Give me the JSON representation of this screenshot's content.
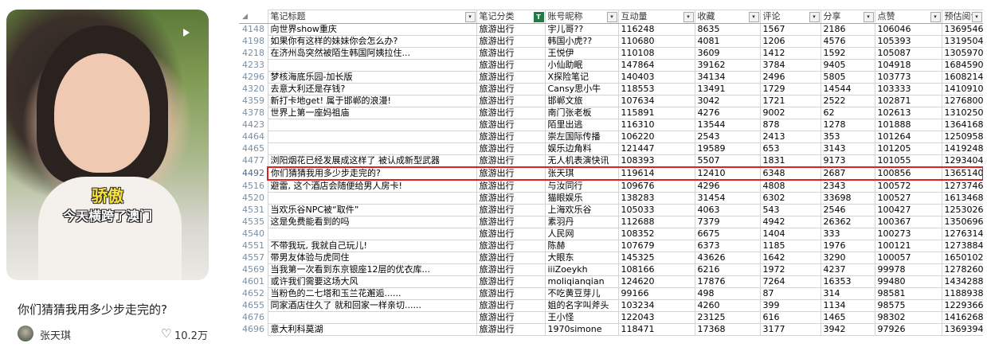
{
  "card": {
    "caption_line1": "骄傲",
    "caption_line2": "今天横跨了澳门",
    "title": "你们猜猜我用多少步走完的?",
    "author": "张天琪",
    "likes": "10.2万",
    "icons": {
      "play": "play-icon",
      "heart": "heart-icon"
    }
  },
  "sheet": {
    "corner": "◢",
    "headers": [
      "笔记标题",
      "笔记分类",
      "账号昵称",
      "互动量",
      "收藏",
      "评论",
      "分享",
      "点赞",
      "预估阅读"
    ],
    "selected_row": "4492",
    "rows": [
      {
        "n": "4148",
        "c": [
          "向世界show重庆",
          "旅游出行",
          "宇儿哥??",
          "116248",
          "8635",
          "1567",
          "2186",
          "106046",
          "1369546"
        ]
      },
      {
        "n": "4198",
        "c": [
          "如果你有这样的妹妹你会怎么办?",
          "旅游出行",
          "韩国小虎??",
          "110680",
          "4081",
          "1206",
          "4576",
          "105393",
          "1319504"
        ]
      },
      {
        "n": "4218",
        "c": [
          "在济州岛突然被陌生韩国阿姨拉住...",
          "旅游出行",
          "王悦伊",
          "110108",
          "3609",
          "1412",
          "1592",
          "105087",
          "1305970"
        ]
      },
      {
        "n": "4233",
        "c": [
          "",
          "旅游出行",
          "小仙助眠",
          "147864",
          "39162",
          "3784",
          "9405",
          "104918",
          "1684590"
        ]
      },
      {
        "n": "4296",
        "c": [
          "梦核海底乐园-加长版",
          "旅游出行",
          "X探险笔记",
          "140403",
          "34134",
          "2496",
          "5805",
          "103773",
          "1608214"
        ]
      },
      {
        "n": "4320",
        "c": [
          "去意大利还是存钱?",
          "旅游出行",
          "Cansy思小牛",
          "118553",
          "13491",
          "1729",
          "14544",
          "103333",
          "1410910"
        ]
      },
      {
        "n": "4359",
        "c": [
          "新打卡地get! 属于邯郸的浪漫!",
          "旅游出行",
          "邯郸文旅",
          "107634",
          "3042",
          "1721",
          "2522",
          "102871",
          "1276800"
        ]
      },
      {
        "n": "4378",
        "c": [
          "世界上第一座妈祖庙",
          "旅游出行",
          "南门张老板",
          "115891",
          "4276",
          "9002",
          "62",
          "102613",
          "1310250"
        ]
      },
      {
        "n": "4423",
        "c": [
          "",
          "旅游出行",
          "陌里出逃",
          "116310",
          "13544",
          "878",
          "1278",
          "101888",
          "1364168"
        ]
      },
      {
        "n": "4464",
        "c": [
          "",
          "旅游出行",
          "崇左国际传播",
          "106220",
          "2543",
          "2413",
          "353",
          "101264",
          "1250958"
        ]
      },
      {
        "n": "4465",
        "c": [
          "",
          "旅游出行",
          "娱乐边角料",
          "121447",
          "19589",
          "653",
          "3143",
          "101205",
          "1419248"
        ]
      },
      {
        "n": "4477",
        "c": [
          "浏阳烟花已经发展成这样了 被认成新型武器",
          "旅游出行",
          "无人机表演快讯",
          "108393",
          "5507",
          "1831",
          "9173",
          "101055",
          "1293404"
        ]
      },
      {
        "n": "4492",
        "c": [
          "你们猜猜我用多少步走完的?",
          "旅游出行",
          "张天琪",
          "119614",
          "12410",
          "6348",
          "2687",
          "100856",
          "1365140"
        ]
      },
      {
        "n": "4516",
        "c": [
          "避雷, 这个酒店会随便给男人房卡!",
          "旅游出行",
          "与汝同行",
          "109676",
          "4296",
          "4808",
          "2343",
          "100572",
          "1273746"
        ]
      },
      {
        "n": "4520",
        "c": [
          "",
          "旅游出行",
          "猫眼娱乐",
          "138283",
          "31454",
          "6302",
          "33698",
          "100527",
          "1613468"
        ]
      },
      {
        "n": "4531",
        "c": [
          "当欢乐谷NPC被“取件”",
          "旅游出行",
          "上海欢乐谷",
          "105033",
          "4063",
          "543",
          "2546",
          "100427",
          "1253026"
        ]
      },
      {
        "n": "4535",
        "c": [
          "这是免费能看到的吗",
          "旅游出行",
          "素羽丹",
          "112688",
          "7379",
          "4942",
          "26362",
          "100367",
          "1350696"
        ]
      },
      {
        "n": "4540",
        "c": [
          "",
          "旅游出行",
          "人民网",
          "108352",
          "6675",
          "1404",
          "333",
          "100273",
          "1276314"
        ]
      },
      {
        "n": "4551",
        "c": [
          "不带我玩, 我就自己玩儿!",
          "旅游出行",
          "陈赫",
          "107679",
          "6373",
          "1185",
          "1976",
          "100121",
          "1273884"
        ]
      },
      {
        "n": "4557",
        "c": [
          "带男友体验与虎同住",
          "旅游出行",
          "大眼东",
          "145325",
          "43626",
          "1642",
          "3290",
          "100057",
          "1650102"
        ]
      },
      {
        "n": "4569",
        "c": [
          "当我第一次看到东京银座12层的优衣库...",
          "旅游出行",
          "iiiZoeykh",
          "108166",
          "6216",
          "1972",
          "4237",
          "99978",
          "1278260"
        ]
      },
      {
        "n": "4601",
        "c": [
          "或许我们需要这场大风",
          "旅游出行",
          "moliqianqian",
          "124620",
          "17876",
          "7264",
          "16353",
          "99480",
          "1434288"
        ]
      },
      {
        "n": "4652",
        "c": [
          "当粉色的二七塔和玉兰花邂逅......",
          "旅游出行",
          "不吃黄豆芽儿",
          "99166",
          "498",
          "87",
          "314",
          "98581",
          "1188938"
        ]
      },
      {
        "n": "4655",
        "c": [
          "同家酒店住久了 就和回家一样亲切......",
          "旅游出行",
          "姐的名字叫斧头",
          "103234",
          "4260",
          "399",
          "1134",
          "98575",
          "1229366"
        ]
      },
      {
        "n": "4676",
        "c": [
          "",
          "旅游出行",
          "王小怪",
          "122043",
          "23125",
          "616",
          "1465",
          "98302",
          "1416268"
        ]
      },
      {
        "n": "4696",
        "c": [
          "意大利科莫湖",
          "旅游出行",
          "1970simone",
          "118471",
          "17368",
          "3177",
          "3942",
          "97926",
          "1369394"
        ]
      }
    ]
  }
}
